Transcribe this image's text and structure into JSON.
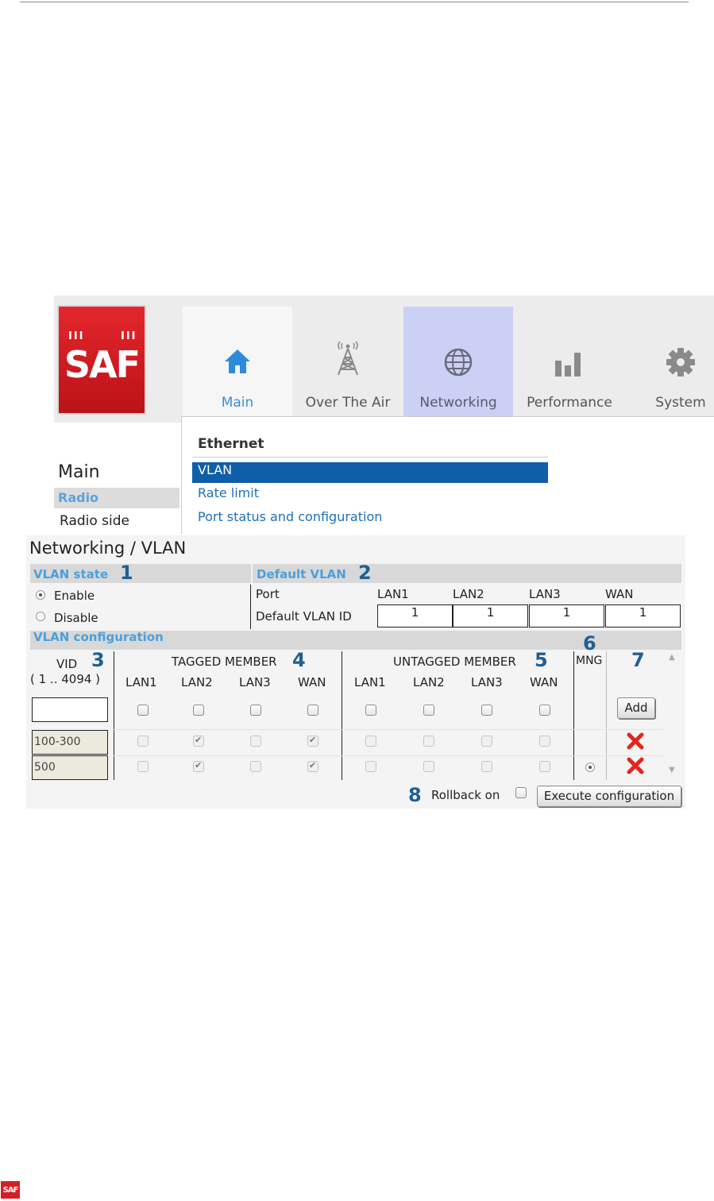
{
  "nav": {
    "logo_text": "SAF",
    "tabs": [
      {
        "label": "Main",
        "icon": "home-icon"
      },
      {
        "label": "Over The Air",
        "icon": "antenna-icon"
      },
      {
        "label": "Networking",
        "icon": "globe-icon"
      },
      {
        "label": "Performance",
        "icon": "bar-chart-icon"
      },
      {
        "label": "System",
        "icon": "gear-icon"
      }
    ],
    "active_tab": "Networking"
  },
  "sidebar": {
    "title": "Main",
    "items": [
      {
        "label": "Radio",
        "selected": true
      },
      {
        "label": "Radio side"
      }
    ]
  },
  "dropdown": {
    "header": "Ethernet",
    "items": [
      {
        "label": "VLAN",
        "selected": true
      },
      {
        "label": "Rate limit"
      },
      {
        "label": "Port status and configuration"
      }
    ]
  },
  "page": {
    "title": "Networking / VLAN"
  },
  "vlan_state": {
    "header": "VLAN state",
    "callout": "1",
    "options": [
      {
        "label": "Enable",
        "selected": true
      },
      {
        "label": "Disable",
        "selected": false
      }
    ]
  },
  "default_vlan": {
    "header": "Default VLAN",
    "callout": "2",
    "port_label": "Port",
    "id_label": "Default VLAN ID",
    "ports": [
      "LAN1",
      "LAN2",
      "LAN3",
      "WAN"
    ],
    "ids": [
      "1",
      "1",
      "1",
      "1"
    ]
  },
  "vlan_config": {
    "header": "VLAN configuration",
    "vid_label": "VID",
    "vid_range": "( 1 .. 4094 )",
    "tagged_label": "TAGGED MEMBER",
    "untagged_label": "UNTAGGED MEMBER",
    "mng_label": "MNG",
    "callouts": {
      "vid": "3",
      "tagged": "4",
      "untagged": "5",
      "mng": "6",
      "delete": "7",
      "rollback": "8"
    },
    "ports": [
      "LAN1",
      "LAN2",
      "LAN3",
      "WAN"
    ],
    "new_row": {
      "vid": "",
      "add_label": "Add"
    },
    "rows": [
      {
        "vid": "100-300",
        "tagged": [
          false,
          true,
          false,
          true
        ],
        "untagged": [
          false,
          false,
          false,
          false
        ],
        "mng": false
      },
      {
        "vid": "500",
        "tagged": [
          false,
          true,
          false,
          true
        ],
        "untagged": [
          false,
          false,
          false,
          false
        ],
        "mng": true
      }
    ],
    "rollback_label": "Rollback on",
    "rollback_checked": false,
    "execute_label": "Execute configuration"
  },
  "footer": {
    "logo_text": "SAF"
  },
  "colors": {
    "brand_red": "#e5262c",
    "accent_blue": "#4aa0dc",
    "menu_selected": "#0f5ea8",
    "callout_blue": "#205f93",
    "active_tab_bg": "#ccd0f5"
  }
}
